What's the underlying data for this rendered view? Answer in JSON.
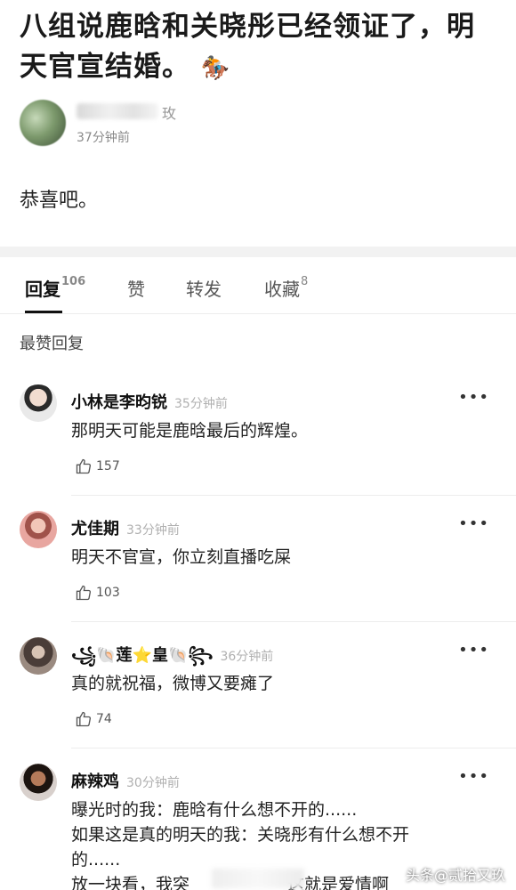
{
  "post": {
    "title": "八组说鹿晗和关晓彤已经领证了，明天官宣结婚。",
    "title_emoji": "🏇",
    "author_name_visible": "玫",
    "time": "37分钟前",
    "body": "恭喜吧。"
  },
  "tabs": [
    {
      "label": "回复",
      "count": "106",
      "active": true
    },
    {
      "label": "赞",
      "count": ""
    },
    {
      "label": "转发",
      "count": ""
    },
    {
      "label": "收藏",
      "count": "8"
    }
  ],
  "section_label": "最赞回复",
  "comments": [
    {
      "name": "小林是李昀锐",
      "time": "35分钟前",
      "text": [
        "那明天可能是鹿晗最后的辉煌。"
      ],
      "likes": "157"
    },
    {
      "name": "尤佳期",
      "time": "33分钟前",
      "text": [
        "明天不官宣，你立刻直播吃屎"
      ],
      "likes": "103"
    },
    {
      "name": "꧁🐚莲⭐皇🐚꧂",
      "time": "36分钟前",
      "text": [
        "真的就祝福，微博又要瘫了"
      ],
      "likes": "74"
    },
    {
      "name": "麻辣鸡",
      "time": "30分钟前",
      "text": [
        "曝光时的我：鹿晗有什么想不开的......",
        "如果这是真的明天的我：关晓彤有什么想不开",
        "的......",
        "放一块看，我突",
        "这就是爱情啊"
      ],
      "likes": ""
    }
  ],
  "more_glyph": "•••",
  "watermark": "头条@贰拾又玖"
}
